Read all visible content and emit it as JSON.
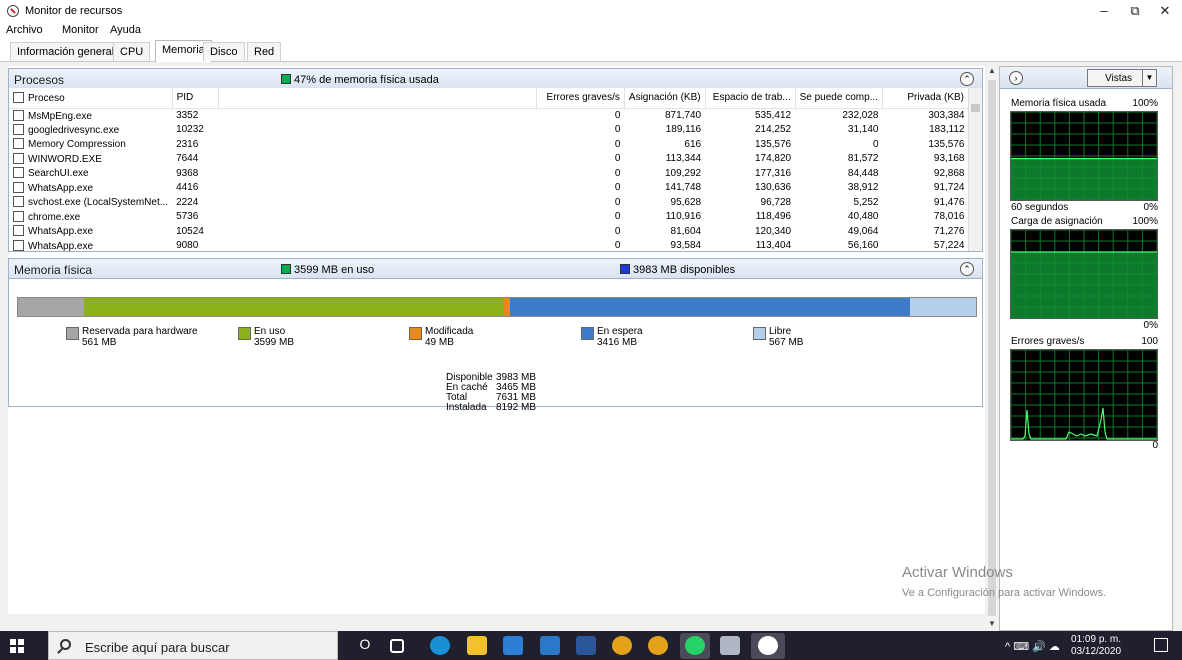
{
  "window": {
    "title": "Monitor de recursos",
    "minimize_glyph": "–",
    "restore_glyph": "⧉",
    "close_glyph": "✕"
  },
  "menu": [
    "Archivo",
    "Monitor",
    "Ayuda"
  ],
  "tabs": [
    {
      "label": "Información general"
    },
    {
      "label": "CPU"
    },
    {
      "label": "Memoria",
      "active": true
    },
    {
      "label": "Disco"
    },
    {
      "label": "Red"
    }
  ],
  "processes": {
    "title": "Procesos",
    "summary": "47% de memoria física usada",
    "summary_color": "#00b050",
    "columns": {
      "proceso": "Proceso",
      "pid": "PID",
      "errores": "Errores graves/s",
      "asignacion": "Asignación (KB)",
      "espacio": "Espacio de trab...",
      "compartible": "Se puede comp...",
      "privada": "Privada (KB)"
    },
    "rows": [
      {
        "name": "MsMpEng.exe",
        "pid": "3352",
        "faults": "0",
        "commit": "871,740",
        "working": "535,412",
        "shareable": "232,028",
        "private": "303,384"
      },
      {
        "name": "googledrivesync.exe",
        "pid": "10232",
        "faults": "0",
        "commit": "189,116",
        "working": "214,252",
        "shareable": "31,140",
        "private": "183,112"
      },
      {
        "name": "Memory Compression",
        "pid": "2316",
        "faults": "0",
        "commit": "616",
        "working": "135,576",
        "shareable": "0",
        "private": "135,576"
      },
      {
        "name": "WINWORD.EXE",
        "pid": "7644",
        "faults": "0",
        "commit": "113,344",
        "working": "174,820",
        "shareable": "81,572",
        "private": "93,168"
      },
      {
        "name": "SearchUI.exe",
        "pid": "9368",
        "faults": "0",
        "commit": "109,292",
        "working": "177,316",
        "shareable": "84,448",
        "private": "92,868"
      },
      {
        "name": "WhatsApp.exe",
        "pid": "4416",
        "faults": "0",
        "commit": "141,748",
        "working": "130,636",
        "shareable": "38,912",
        "private": "91,724"
      },
      {
        "name": "svchost.exe (LocalSystemNet...",
        "pid": "2224",
        "faults": "0",
        "commit": "95,628",
        "working": "96,728",
        "shareable": "5,252",
        "private": "91,476"
      },
      {
        "name": "chrome.exe",
        "pid": "5736",
        "faults": "0",
        "commit": "110,916",
        "working": "118,496",
        "shareable": "40,480",
        "private": "78,016"
      },
      {
        "name": "WhatsApp.exe",
        "pid": "10524",
        "faults": "0",
        "commit": "81,604",
        "working": "120,340",
        "shareable": "49,064",
        "private": "71,276"
      },
      {
        "name": "WhatsApp.exe",
        "pid": "9080",
        "faults": "0",
        "commit": "93,584",
        "working": "113,404",
        "shareable": "56,160",
        "private": "57,224"
      }
    ]
  },
  "physical_memory": {
    "title": "Memoria física",
    "in_use_summary": "3599 MB en uso",
    "in_use_color": "#00b050",
    "available_summary": "3983 MB disponibles",
    "available_color": "#1c3ccf",
    "segments": [
      {
        "label": "Reservada para hardware",
        "value": "561 MB",
        "mb": 561,
        "color": "#a6a6a6"
      },
      {
        "label": "En uso",
        "value": "3599 MB",
        "mb": 3599,
        "color": "#8cb11a"
      },
      {
        "label": "Modificada",
        "value": "49 MB",
        "mb": 49,
        "color": "#e68a1a"
      },
      {
        "label": "En espera",
        "value": "3416 MB",
        "mb": 3416,
        "color": "#3d7cc9"
      },
      {
        "label": "Libre",
        "value": "567 MB",
        "mb": 567,
        "color": "#b6cfec"
      }
    ],
    "stats": [
      {
        "label": "Disponible",
        "value": "3983 MB"
      },
      {
        "label": "En caché",
        "value": "3465 MB"
      },
      {
        "label": "Total",
        "value": "7631 MB"
      },
      {
        "label": "Instalada",
        "value": "8192 MB"
      }
    ]
  },
  "right_panel": {
    "views_label": "Vistas",
    "expand_glyph": "›",
    "dropdown_glyph": "▼",
    "graphs": [
      {
        "title": "Memoria física usada",
        "max": "100%",
        "min": "0%",
        "time": "60 segundos",
        "level": 0.47
      },
      {
        "title": "Carga de asignación",
        "max": "100%",
        "min": "0%",
        "level": 0.75
      },
      {
        "title": "Errores graves/s",
        "max": "100",
        "min": "0"
      }
    ]
  },
  "watermark": {
    "line1": "Activar Windows",
    "line2": "Ve a Configuración para activar Windows."
  },
  "taskbar": {
    "search_placeholder": "Escribe aquí para buscar",
    "time": "01:09 p. m.",
    "date": "03/12/2020",
    "tray_text": "^ ⌨ 🔊 ☁",
    "task_view_glyph": "O"
  }
}
